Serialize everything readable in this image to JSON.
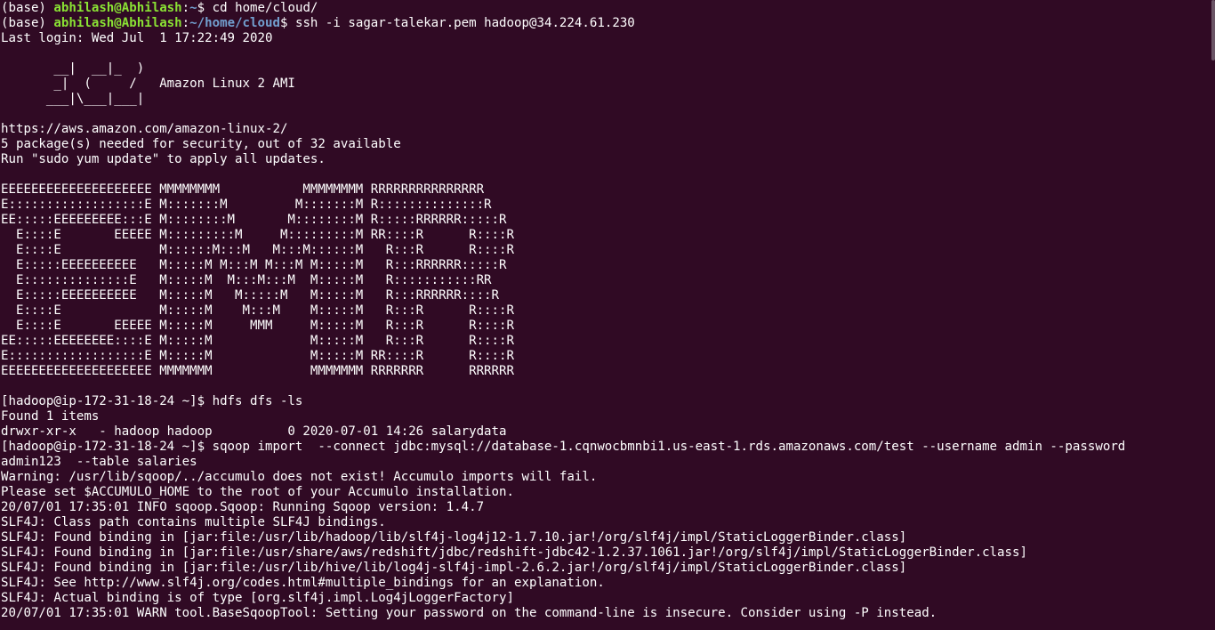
{
  "terminal": {
    "lines": [
      [
        {
          "t": "(base) "
        },
        {
          "t": "abhilash@Abhilash",
          "c": "user"
        },
        {
          "t": ":"
        },
        {
          "t": "~",
          "c": "path"
        },
        {
          "t": "$ cd home/cloud/"
        }
      ],
      [
        {
          "t": "(base) "
        },
        {
          "t": "abhilash@Abhilash",
          "c": "user"
        },
        {
          "t": ":"
        },
        {
          "t": "~/home/cloud",
          "c": "path"
        },
        {
          "t": "$ ssh -i sagar-talekar.pem hadoop@34.224.61.230"
        }
      ],
      [
        {
          "t": "Last login: Wed Jul  1 17:22:49 2020"
        }
      ],
      [
        {
          "t": ""
        }
      ],
      [
        {
          "t": "       __|  __|_  )"
        }
      ],
      [
        {
          "t": "       _|  (     /   Amazon Linux 2 AMI"
        }
      ],
      [
        {
          "t": "      ___|\\___|___|"
        }
      ],
      [
        {
          "t": ""
        }
      ],
      [
        {
          "t": "https://aws.amazon.com/amazon-linux-2/"
        }
      ],
      [
        {
          "t": "5 package(s) needed for security, out of 32 available"
        }
      ],
      [
        {
          "t": "Run \"sudo yum update\" to apply all updates."
        }
      ],
      [
        {
          "t": ""
        }
      ],
      [
        {
          "t": "EEEEEEEEEEEEEEEEEEEE MMMMMMMM           MMMMMMMM RRRRRRRRRRRRRRR"
        }
      ],
      [
        {
          "t": "E::::::::::::::::::E M:::::::M         M:::::::M R::::::::::::::R"
        }
      ],
      [
        {
          "t": "EE:::::EEEEEEEEE:::E M::::::::M       M::::::::M R:::::RRRRRR:::::R"
        }
      ],
      [
        {
          "t": "  E::::E       EEEEE M:::::::::M     M:::::::::M RR::::R      R::::R"
        }
      ],
      [
        {
          "t": "  E::::E             M::::::M:::M   M:::M::::::M   R:::R      R::::R"
        }
      ],
      [
        {
          "t": "  E:::::EEEEEEEEEE   M:::::M M:::M M:::M M:::::M   R:::RRRRRR:::::R"
        }
      ],
      [
        {
          "t": "  E::::::::::::::E   M:::::M  M:::M:::M  M:::::M   R:::::::::::RR"
        }
      ],
      [
        {
          "t": "  E:::::EEEEEEEEEE   M:::::M   M:::::M   M:::::M   R:::RRRRRR::::R"
        }
      ],
      [
        {
          "t": "  E::::E             M:::::M    M:::M    M:::::M   R:::R      R::::R"
        }
      ],
      [
        {
          "t": "  E::::E       EEEEE M:::::M     MMM     M:::::M   R:::R      R::::R"
        }
      ],
      [
        {
          "t": "EE:::::EEEEEEEE::::E M:::::M             M:::::M   R:::R      R::::R"
        }
      ],
      [
        {
          "t": "E::::::::::::::::::E M:::::M             M:::::M RR::::R      R::::R"
        }
      ],
      [
        {
          "t": "EEEEEEEEEEEEEEEEEEEE MMMMMMM             MMMMMMM RRRRRRR      RRRRRR"
        }
      ],
      [
        {
          "t": ""
        }
      ],
      [
        {
          "t": "[hadoop@ip-172-31-18-24 ~]$ hdfs dfs -ls"
        }
      ],
      [
        {
          "t": "Found 1 items"
        }
      ],
      [
        {
          "t": "drwxr-xr-x   - hadoop hadoop          0 2020-07-01 14:26 salarydata"
        }
      ],
      [
        {
          "t": "[hadoop@ip-172-31-18-24 ~]$ sqoop import  --connect jdbc:mysql://database-1.cqnwocbmnbi1.us-east-1.rds.amazonaws.com/test --username admin --password"
        }
      ],
      [
        {
          "t": "admin123  --table salaries"
        }
      ],
      [
        {
          "t": "Warning: /usr/lib/sqoop/../accumulo does not exist! Accumulo imports will fail."
        }
      ],
      [
        {
          "t": "Please set $ACCUMULO_HOME to the root of your Accumulo installation."
        }
      ],
      [
        {
          "t": "20/07/01 17:35:01 INFO sqoop.Sqoop: Running Sqoop version: 1.4.7"
        }
      ],
      [
        {
          "t": "SLF4J: Class path contains multiple SLF4J bindings."
        }
      ],
      [
        {
          "t": "SLF4J: Found binding in [jar:file:/usr/lib/hadoop/lib/slf4j-log4j12-1.7.10.jar!/org/slf4j/impl/StaticLoggerBinder.class]"
        }
      ],
      [
        {
          "t": "SLF4J: Found binding in [jar:file:/usr/share/aws/redshift/jdbc/redshift-jdbc42-1.2.37.1061.jar!/org/slf4j/impl/StaticLoggerBinder.class]"
        }
      ],
      [
        {
          "t": "SLF4J: Found binding in [jar:file:/usr/lib/hive/lib/log4j-slf4j-impl-2.6.2.jar!/org/slf4j/impl/StaticLoggerBinder.class]"
        }
      ],
      [
        {
          "t": "SLF4J: See http://www.slf4j.org/codes.html#multiple_bindings for an explanation."
        }
      ],
      [
        {
          "t": "SLF4J: Actual binding is of type [org.slf4j.impl.Log4jLoggerFactory]"
        }
      ],
      [
        {
          "t": "20/07/01 17:35:01 WARN tool.BaseSqoopTool: Setting your password on the command-line is insecure. Consider using -P instead."
        }
      ]
    ]
  },
  "colors": {
    "background": "#300a24",
    "text": "#ffffff",
    "prompt_user": "#8ae234",
    "prompt_path": "#729fcf"
  }
}
